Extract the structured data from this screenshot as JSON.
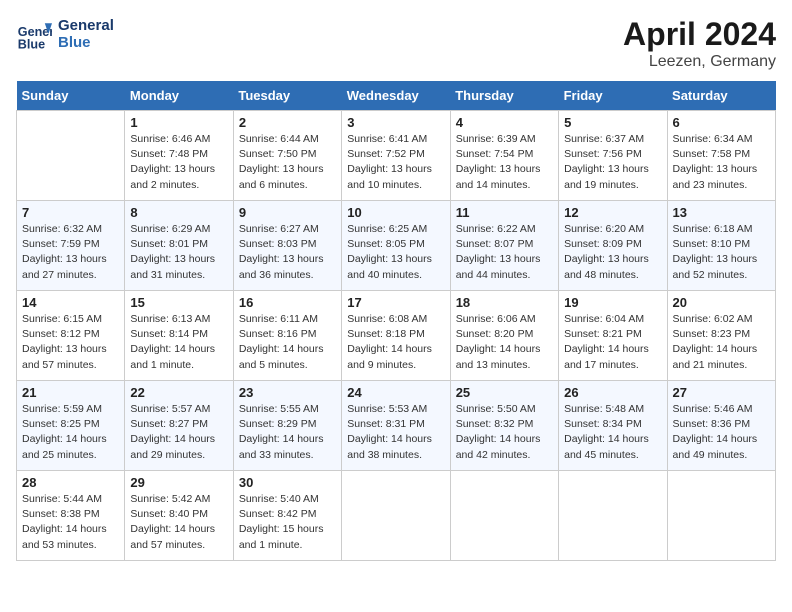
{
  "header": {
    "logo_line1": "General",
    "logo_line2": "Blue",
    "month": "April 2024",
    "location": "Leezen, Germany"
  },
  "weekdays": [
    "Sunday",
    "Monday",
    "Tuesday",
    "Wednesday",
    "Thursday",
    "Friday",
    "Saturday"
  ],
  "weeks": [
    [
      {
        "day": "",
        "sunrise": "",
        "sunset": "",
        "daylight": ""
      },
      {
        "day": "1",
        "sunrise": "Sunrise: 6:46 AM",
        "sunset": "Sunset: 7:48 PM",
        "daylight": "Daylight: 13 hours and 2 minutes."
      },
      {
        "day": "2",
        "sunrise": "Sunrise: 6:44 AM",
        "sunset": "Sunset: 7:50 PM",
        "daylight": "Daylight: 13 hours and 6 minutes."
      },
      {
        "day": "3",
        "sunrise": "Sunrise: 6:41 AM",
        "sunset": "Sunset: 7:52 PM",
        "daylight": "Daylight: 13 hours and 10 minutes."
      },
      {
        "day": "4",
        "sunrise": "Sunrise: 6:39 AM",
        "sunset": "Sunset: 7:54 PM",
        "daylight": "Daylight: 13 hours and 14 minutes."
      },
      {
        "day": "5",
        "sunrise": "Sunrise: 6:37 AM",
        "sunset": "Sunset: 7:56 PM",
        "daylight": "Daylight: 13 hours and 19 minutes."
      },
      {
        "day": "6",
        "sunrise": "Sunrise: 6:34 AM",
        "sunset": "Sunset: 7:58 PM",
        "daylight": "Daylight: 13 hours and 23 minutes."
      }
    ],
    [
      {
        "day": "7",
        "sunrise": "Sunrise: 6:32 AM",
        "sunset": "Sunset: 7:59 PM",
        "daylight": "Daylight: 13 hours and 27 minutes."
      },
      {
        "day": "8",
        "sunrise": "Sunrise: 6:29 AM",
        "sunset": "Sunset: 8:01 PM",
        "daylight": "Daylight: 13 hours and 31 minutes."
      },
      {
        "day": "9",
        "sunrise": "Sunrise: 6:27 AM",
        "sunset": "Sunset: 8:03 PM",
        "daylight": "Daylight: 13 hours and 36 minutes."
      },
      {
        "day": "10",
        "sunrise": "Sunrise: 6:25 AM",
        "sunset": "Sunset: 8:05 PM",
        "daylight": "Daylight: 13 hours and 40 minutes."
      },
      {
        "day": "11",
        "sunrise": "Sunrise: 6:22 AM",
        "sunset": "Sunset: 8:07 PM",
        "daylight": "Daylight: 13 hours and 44 minutes."
      },
      {
        "day": "12",
        "sunrise": "Sunrise: 6:20 AM",
        "sunset": "Sunset: 8:09 PM",
        "daylight": "Daylight: 13 hours and 48 minutes."
      },
      {
        "day": "13",
        "sunrise": "Sunrise: 6:18 AM",
        "sunset": "Sunset: 8:10 PM",
        "daylight": "Daylight: 13 hours and 52 minutes."
      }
    ],
    [
      {
        "day": "14",
        "sunrise": "Sunrise: 6:15 AM",
        "sunset": "Sunset: 8:12 PM",
        "daylight": "Daylight: 13 hours and 57 minutes."
      },
      {
        "day": "15",
        "sunrise": "Sunrise: 6:13 AM",
        "sunset": "Sunset: 8:14 PM",
        "daylight": "Daylight: 14 hours and 1 minute."
      },
      {
        "day": "16",
        "sunrise": "Sunrise: 6:11 AM",
        "sunset": "Sunset: 8:16 PM",
        "daylight": "Daylight: 14 hours and 5 minutes."
      },
      {
        "day": "17",
        "sunrise": "Sunrise: 6:08 AM",
        "sunset": "Sunset: 8:18 PM",
        "daylight": "Daylight: 14 hours and 9 minutes."
      },
      {
        "day": "18",
        "sunrise": "Sunrise: 6:06 AM",
        "sunset": "Sunset: 8:20 PM",
        "daylight": "Daylight: 14 hours and 13 minutes."
      },
      {
        "day": "19",
        "sunrise": "Sunrise: 6:04 AM",
        "sunset": "Sunset: 8:21 PM",
        "daylight": "Daylight: 14 hours and 17 minutes."
      },
      {
        "day": "20",
        "sunrise": "Sunrise: 6:02 AM",
        "sunset": "Sunset: 8:23 PM",
        "daylight": "Daylight: 14 hours and 21 minutes."
      }
    ],
    [
      {
        "day": "21",
        "sunrise": "Sunrise: 5:59 AM",
        "sunset": "Sunset: 8:25 PM",
        "daylight": "Daylight: 14 hours and 25 minutes."
      },
      {
        "day": "22",
        "sunrise": "Sunrise: 5:57 AM",
        "sunset": "Sunset: 8:27 PM",
        "daylight": "Daylight: 14 hours and 29 minutes."
      },
      {
        "day": "23",
        "sunrise": "Sunrise: 5:55 AM",
        "sunset": "Sunset: 8:29 PM",
        "daylight": "Daylight: 14 hours and 33 minutes."
      },
      {
        "day": "24",
        "sunrise": "Sunrise: 5:53 AM",
        "sunset": "Sunset: 8:31 PM",
        "daylight": "Daylight: 14 hours and 38 minutes."
      },
      {
        "day": "25",
        "sunrise": "Sunrise: 5:50 AM",
        "sunset": "Sunset: 8:32 PM",
        "daylight": "Daylight: 14 hours and 42 minutes."
      },
      {
        "day": "26",
        "sunrise": "Sunrise: 5:48 AM",
        "sunset": "Sunset: 8:34 PM",
        "daylight": "Daylight: 14 hours and 45 minutes."
      },
      {
        "day": "27",
        "sunrise": "Sunrise: 5:46 AM",
        "sunset": "Sunset: 8:36 PM",
        "daylight": "Daylight: 14 hours and 49 minutes."
      }
    ],
    [
      {
        "day": "28",
        "sunrise": "Sunrise: 5:44 AM",
        "sunset": "Sunset: 8:38 PM",
        "daylight": "Daylight: 14 hours and 53 minutes."
      },
      {
        "day": "29",
        "sunrise": "Sunrise: 5:42 AM",
        "sunset": "Sunset: 8:40 PM",
        "daylight": "Daylight: 14 hours and 57 minutes."
      },
      {
        "day": "30",
        "sunrise": "Sunrise: 5:40 AM",
        "sunset": "Sunset: 8:42 PM",
        "daylight": "Daylight: 15 hours and 1 minute."
      },
      {
        "day": "",
        "sunrise": "",
        "sunset": "",
        "daylight": ""
      },
      {
        "day": "",
        "sunrise": "",
        "sunset": "",
        "daylight": ""
      },
      {
        "day": "",
        "sunrise": "",
        "sunset": "",
        "daylight": ""
      },
      {
        "day": "",
        "sunrise": "",
        "sunset": "",
        "daylight": ""
      }
    ]
  ]
}
